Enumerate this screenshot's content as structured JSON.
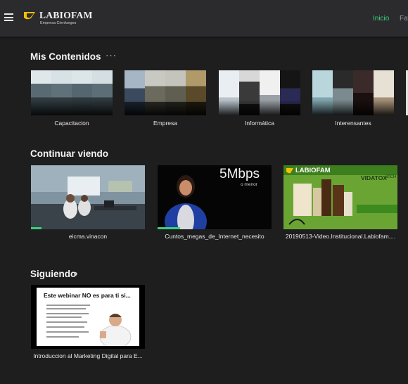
{
  "header": {
    "logo_name": "LABIOFAM",
    "logo_subtitle": "Empresa Cienfuegos",
    "nav": {
      "inicio": "Inicio",
      "favoritos": "Fav"
    }
  },
  "sections": {
    "mis_contenidos": {
      "title": "Mis Contenidos",
      "more_label": "···",
      "items": [
        {
          "label": "Capacitacion"
        },
        {
          "label": "Empresa"
        },
        {
          "label": "Informática"
        },
        {
          "label": "Interensantes"
        }
      ]
    },
    "continuar_viendo": {
      "title": "Continuar viendo",
      "items": [
        {
          "label": "eicma.vinacon",
          "progress": 0.09
        },
        {
          "label": "Cuntos_megas_de_Internet_necesito",
          "progress": 0.2,
          "overlay_big": "5Mbps",
          "overlay_small": "o menor"
        },
        {
          "label": "20190513-Video.Institucional.Labiofam....",
          "progress": 0,
          "brand": "LABIOFAM",
          "product": "VIDATOX",
          "product_sub": "30CH"
        }
      ]
    },
    "siguiendo": {
      "title": "Siguiendo",
      "chevron": "›",
      "items": [
        {
          "label": "Introduccion al Marketing Digital para E...",
          "slide_title": "Este webinar NO es para ti si..."
        }
      ]
    }
  },
  "colors": {
    "accent": "#3ad07a",
    "background": "#1e1e1f",
    "header": "#2b2b2d"
  }
}
